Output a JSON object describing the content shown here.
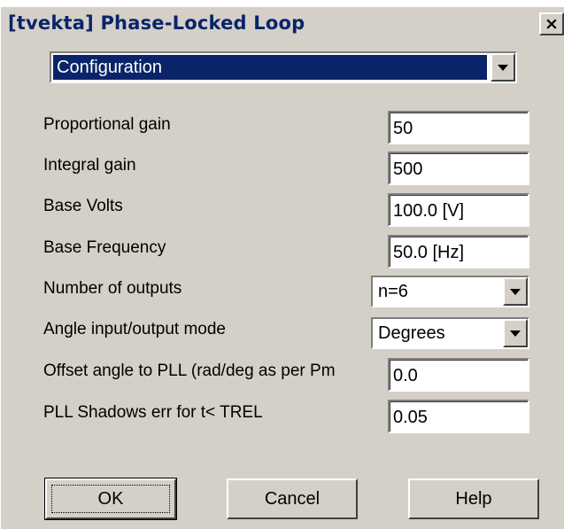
{
  "window": {
    "title": "[tvekta] Phase-Locked Loop",
    "close_glyph": "×"
  },
  "section": {
    "selected": "Configuration"
  },
  "fields": {
    "proportional_gain": {
      "label": "Proportional gain",
      "value": "50"
    },
    "integral_gain": {
      "label": "Integral gain",
      "value": "500"
    },
    "base_volts": {
      "label": "Base Volts",
      "value": "100.0 [V]"
    },
    "base_frequency": {
      "label": "Base Frequency",
      "value": "50.0 [Hz]"
    },
    "number_of_outputs": {
      "label": "Number of outputs",
      "value": "n=6"
    },
    "angle_mode": {
      "label": "Angle input/output mode",
      "value": "Degrees"
    },
    "offset_angle": {
      "label": "Offset angle to PLL (rad/deg as per  Pm",
      "value": "0.0"
    },
    "pll_shadows": {
      "label": "PLL Shadows err for t< TREL",
      "value": "0.05"
    }
  },
  "buttons": {
    "ok": "OK",
    "cancel": "Cancel",
    "help": "Help"
  }
}
